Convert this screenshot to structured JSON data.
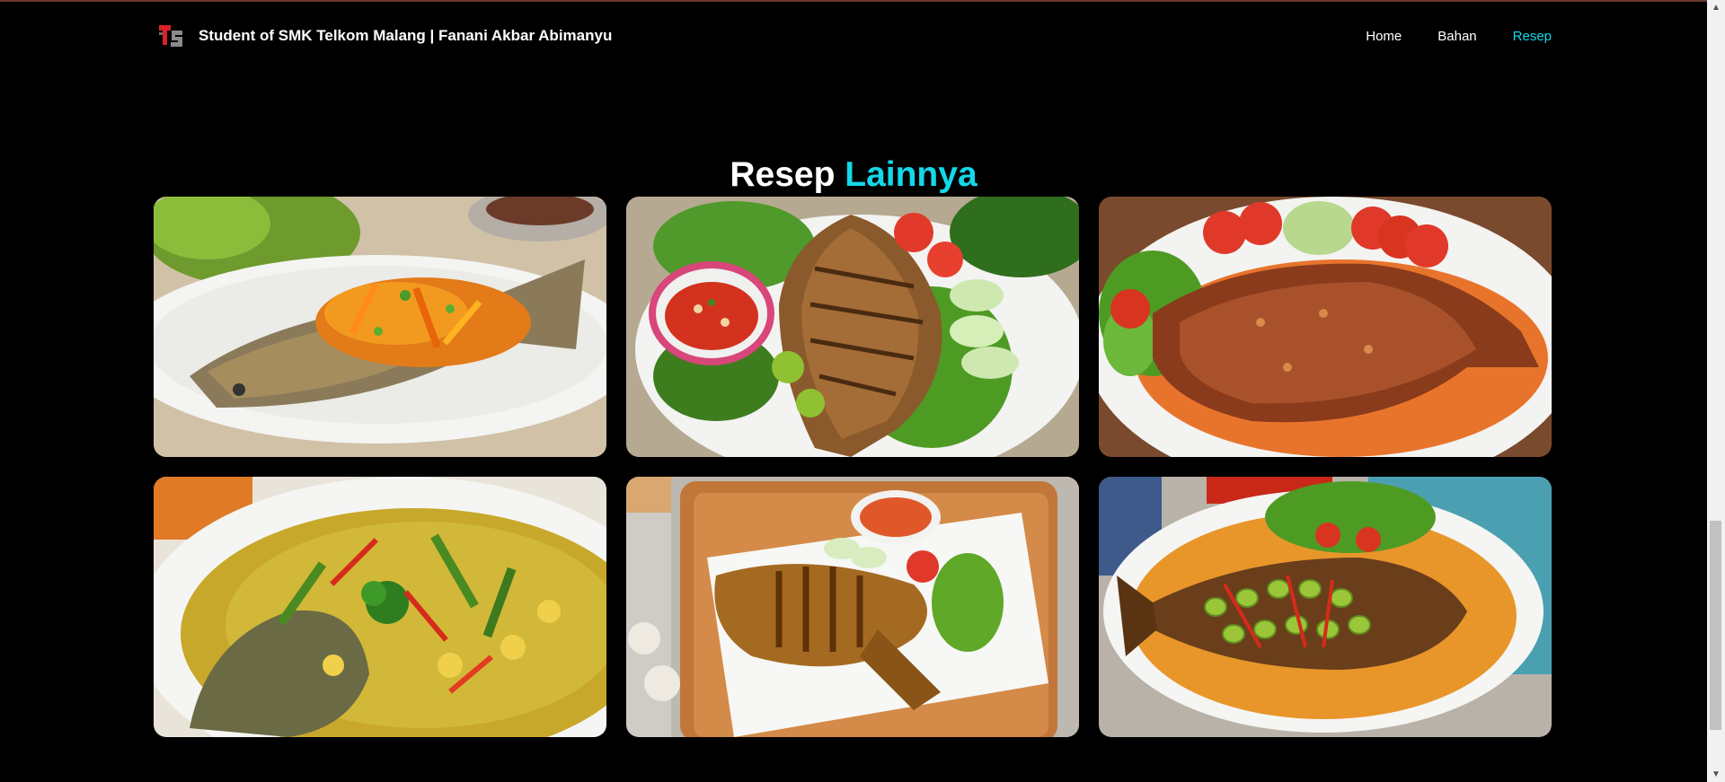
{
  "navbar": {
    "brand_text": "Student of SMK Telkom Malang | Fanani Akbar Abimanyu",
    "logo_icon": "telkom-schools-logo-icon",
    "links": [
      {
        "label": "Home",
        "active": false
      },
      {
        "label": "Bahan",
        "active": false
      },
      {
        "label": "Resep",
        "active": true
      }
    ],
    "accent_color": "#13d8e8"
  },
  "section": {
    "title_main": "Resep",
    "title_accent": "Lainnya"
  },
  "recipes": [
    {
      "image": "fried-fish-sweet-sour-sauce-photo"
    },
    {
      "image": "grilled-fish-with-sambal-photo"
    },
    {
      "image": "fish-with-spicy-topping-photo"
    },
    {
      "image": "fish-in-yellow-curry-photo"
    },
    {
      "image": "fried-gurame-with-sambal-photo"
    },
    {
      "image": "fish-with-petai-sauce-photo"
    }
  ]
}
